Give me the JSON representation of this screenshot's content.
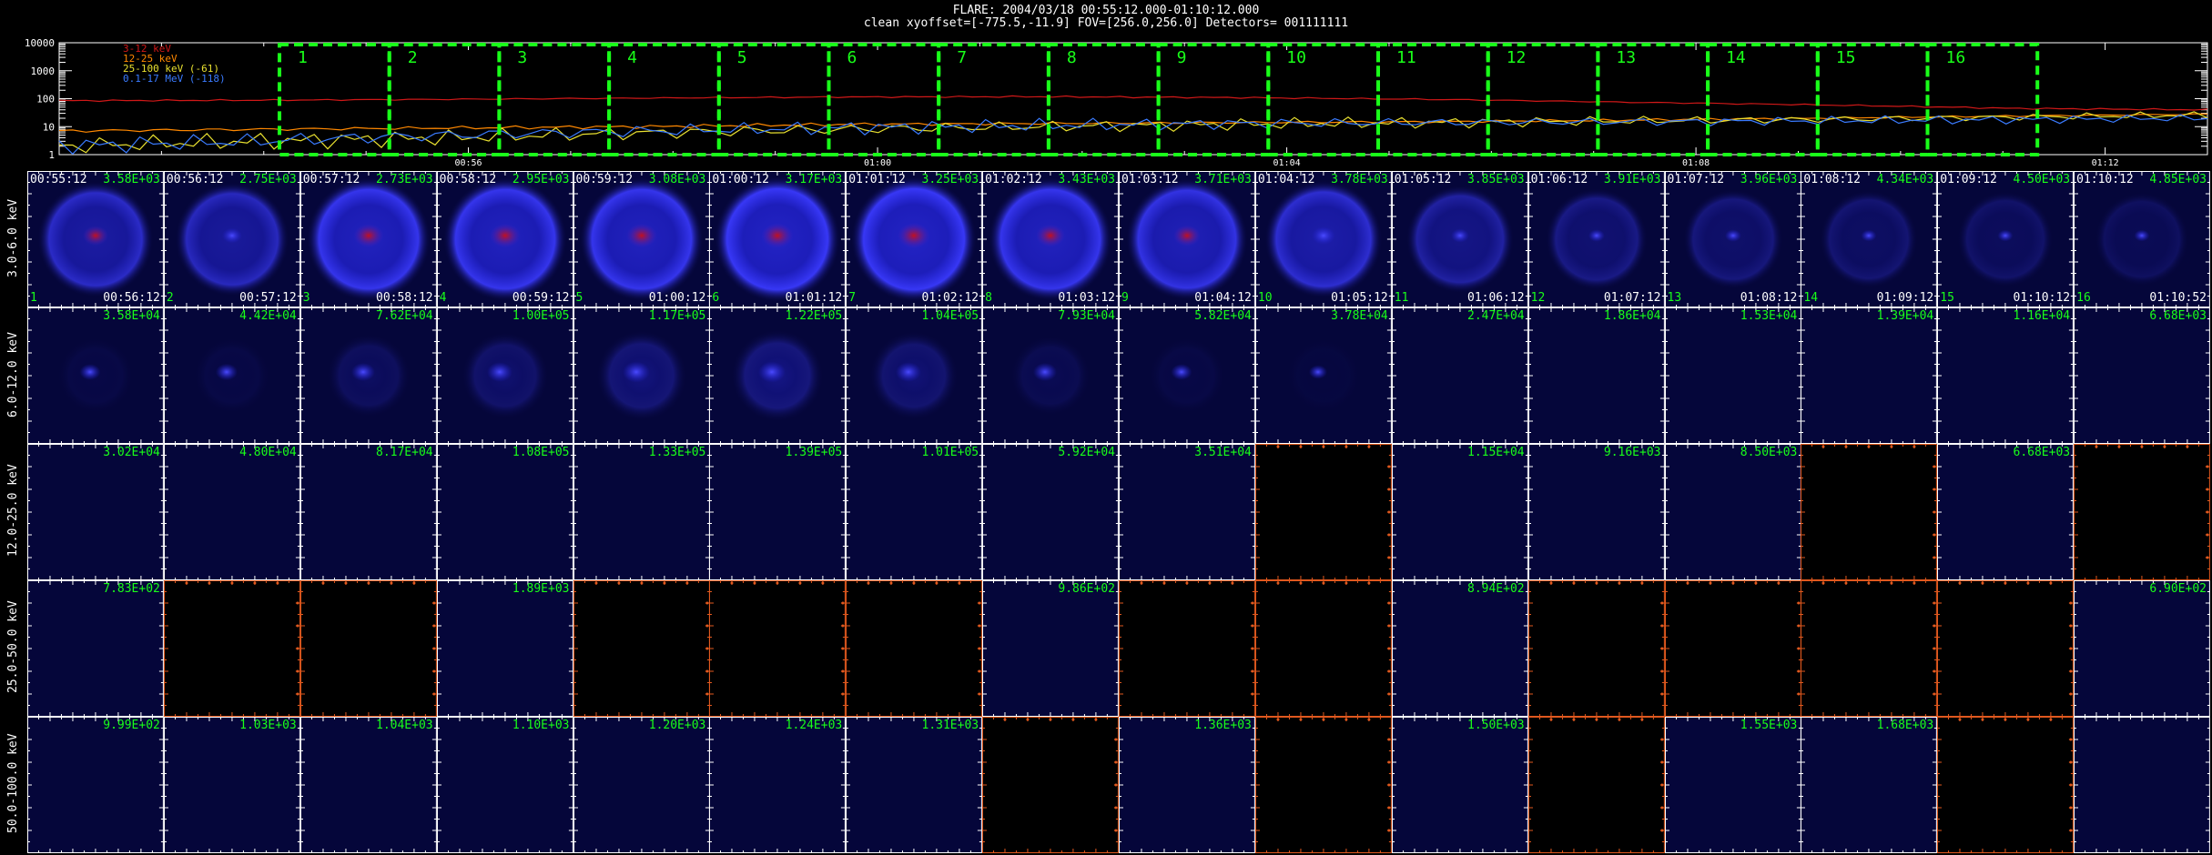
{
  "header": {
    "title": "FLARE: 2004/03/18 00:55:12.000-01:10:12.000",
    "subtitle": "clean    xyoffset=[-775.5,-11.9]    FOV=[256.0,256.0]    Detectors= 001111111"
  },
  "lightcurve": {
    "yticks": [
      "10000",
      "1000",
      "100",
      "10",
      "1"
    ],
    "xticks": [
      "00:56",
      "01:00",
      "01:04",
      "01:08",
      "01:12"
    ],
    "legend": [
      {
        "label": "3-12 keV",
        "color": "#d01818"
      },
      {
        "label": "12-25 keV",
        "color": "#ff8800"
      },
      {
        "label": "25-100 keV (-61)",
        "color": "#e8e030"
      },
      {
        "label": "0.1-17 MeV (-118)",
        "color": "#3a7bff"
      }
    ],
    "boxes": [
      "1",
      "2",
      "3",
      "4",
      "5",
      "6",
      "7",
      "8",
      "9",
      "10",
      "11",
      "12",
      "13",
      "14",
      "15",
      "16"
    ],
    "box_color": "#19ff19"
  },
  "chart_data": {
    "type": "line",
    "title": "FLARE: 2004/03/18 00:55:12.000-01:10:12.000",
    "xlabel": "",
    "ylabel": "",
    "yscale": "log",
    "ylim": [
      1,
      10000
    ],
    "xlim": [
      "00:52",
      "01:13"
    ],
    "x": [
      "00:52",
      "00:54",
      "00:56",
      "00:58",
      "01:00",
      "01:02",
      "01:04",
      "01:06",
      "01:08",
      "01:10",
      "01:12",
      "01:13"
    ],
    "series": [
      {
        "name": "3-12 keV",
        "color": "#d01818",
        "values": [
          85,
          88,
          95,
          105,
          115,
          118,
          110,
          95,
          75,
          60,
          45,
          40
        ]
      },
      {
        "name": "12-25 keV",
        "color": "#ff8800",
        "values": [
          7,
          8,
          9,
          10,
          12,
          13,
          14,
          15,
          17,
          20,
          24,
          28
        ]
      },
      {
        "name": "25-100 keV (-61)",
        "color": "#e8e030",
        "values": [
          2,
          3,
          4,
          6,
          8,
          10,
          12,
          14,
          16,
          18,
          22,
          26
        ]
      },
      {
        "name": "0.1-17 MeV (-118)",
        "color": "#3a7bff",
        "values": [
          2,
          3,
          5,
          7,
          9,
          11,
          13,
          14,
          15,
          16,
          18,
          20
        ]
      }
    ]
  },
  "rows": [
    {
      "label": "3.0-6.0 keV",
      "tl": [
        "00:55:12",
        "00:56:12",
        "00:57:12",
        "00:58:12",
        "00:59:12",
        "01:00:12",
        "01:01:12",
        "01:02:12",
        "01:03:12",
        "01:04:12",
        "01:05:12",
        "01:06:12",
        "01:07:12",
        "01:08:12",
        "01:09:12",
        "01:10:12"
      ],
      "tr": [
        "3.58E+03",
        "2.75E+03",
        "2.73E+03",
        "2.95E+03",
        "3.08E+03",
        "3.17E+03",
        "3.25E+03",
        "3.43E+03",
        "3.71E+03",
        "3.78E+03",
        "3.85E+03",
        "3.91E+03",
        "3.96E+03",
        "4.34E+03",
        "4.50E+03",
        "4.85E+03"
      ],
      "bl": [
        "1",
        "2",
        "3",
        "4",
        "5",
        "6",
        "7",
        "8",
        "9",
        "10",
        "11",
        "12",
        "13",
        "14",
        "15",
        "16"
      ],
      "br": [
        "00:56:12",
        "00:57:12",
        "00:58:12",
        "00:59:12",
        "01:00:12",
        "01:01:12",
        "01:02:12",
        "01:03:12",
        "01:04:12",
        "01:05:12",
        "01:06:12",
        "01:07:12",
        "01:08:12",
        "01:09:12",
        "01:10:12",
        "01:10:52"
      ],
      "intensity": [
        0.75,
        0.7,
        0.95,
        0.95,
        0.95,
        1.0,
        1.0,
        0.95,
        0.9,
        0.8,
        0.55,
        0.4,
        0.35,
        0.3,
        0.25,
        0.2
      ],
      "core": [
        0.6,
        0.3,
        0.85,
        0.9,
        0.9,
        0.95,
        1.0,
        0.8,
        0.7,
        0.5,
        0.2,
        0.1,
        0.1,
        0.05,
        0.05,
        0.05
      ],
      "empty": [
        false,
        false,
        false,
        false,
        false,
        false,
        false,
        false,
        false,
        false,
        false,
        false,
        false,
        false,
        false,
        false
      ]
    },
    {
      "label": "6.0-12.0 keV",
      "tr": [
        "3.58E+04",
        "4.42E+04",
        "7.62E+04",
        "1.00E+05",
        "1.17E+05",
        "1.22E+05",
        "1.04E+05",
        "7.93E+04",
        "5.82E+04",
        "3.78E+04",
        "2.47E+04",
        "1.86E+04",
        "1.53E+04",
        "1.39E+04",
        "1.16E+04",
        "6.68E+03"
      ],
      "intensity": [
        0.1,
        0.1,
        0.3,
        0.4,
        0.5,
        0.55,
        0.45,
        0.2,
        0.1,
        0.05,
        0,
        0,
        0,
        0,
        0,
        0
      ],
      "core": [
        0.35,
        0.4,
        0.5,
        0.6,
        0.7,
        0.7,
        0.6,
        0.5,
        0.35,
        0.2,
        0,
        0,
        0,
        0,
        0,
        0
      ],
      "empty": [
        false,
        false,
        false,
        false,
        false,
        false,
        false,
        false,
        false,
        false,
        false,
        false,
        false,
        false,
        false,
        false
      ]
    },
    {
      "label": "12.0-25.0 keV",
      "tr": [
        "3.02E+04",
        "4.80E+04",
        "8.17E+04",
        "1.08E+05",
        "1.33E+05",
        "1.39E+05",
        "1.01E+05",
        "5.92E+04",
        "3.51E+04",
        "",
        "1.15E+04",
        "9.16E+03",
        "8.50E+03",
        "",
        "6.68E+03",
        ""
      ],
      "intensity": [
        0,
        0,
        0,
        0,
        0,
        0,
        0,
        0,
        0,
        0,
        0,
        0,
        0,
        0,
        0,
        0
      ],
      "core": [
        0,
        0,
        0,
        0,
        0,
        0,
        0,
        0,
        0,
        0,
        0,
        0,
        0,
        0,
        0,
        0
      ],
      "empty": [
        false,
        false,
        false,
        false,
        false,
        false,
        false,
        false,
        false,
        true,
        false,
        false,
        false,
        true,
        false,
        true
      ]
    },
    {
      "label": "25.0-50.0 keV",
      "tr": [
        "7.83E+02",
        "",
        "",
        "1.89E+03",
        "",
        "",
        "",
        "9.86E+02",
        "",
        "",
        "8.94E+02",
        "",
        "",
        "",
        "",
        "6.90E+02"
      ],
      "intensity": [
        0,
        0,
        0,
        0,
        0,
        0,
        0,
        0,
        0,
        0,
        0,
        0,
        0,
        0,
        0,
        0
      ],
      "core": [
        0,
        0,
        0,
        0,
        0,
        0,
        0,
        0,
        0,
        0,
        0,
        0,
        0,
        0,
        0,
        0
      ],
      "empty": [
        false,
        true,
        true,
        false,
        true,
        true,
        true,
        false,
        true,
        true,
        false,
        true,
        true,
        true,
        true,
        false
      ]
    },
    {
      "label": "50.0-100.0 keV",
      "tr": [
        "9.99E+02",
        "1.03E+03",
        "1.04E+03",
        "1.10E+03",
        "1.20E+03",
        "1.24E+03",
        "1.31E+03",
        "",
        "1.36E+03",
        "",
        "1.50E+03",
        "",
        "1.55E+03",
        "1.68E+03",
        "",
        ""
      ],
      "intensity": [
        0,
        0,
        0,
        0,
        0,
        0,
        0,
        0,
        0,
        0,
        0,
        0,
        0,
        0,
        0,
        0
      ],
      "core": [
        0,
        0,
        0,
        0,
        0,
        0,
        0,
        0,
        0,
        0,
        0,
        0,
        0,
        0,
        0,
        0
      ],
      "empty": [
        false,
        false,
        false,
        false,
        false,
        false,
        false,
        true,
        false,
        true,
        false,
        true,
        false,
        false,
        true,
        false
      ]
    },
    {
      "label_color": "#ffffff"
    }
  ],
  "colors": {
    "empty_border": "#e0581e",
    "cell_bg": "#05063a",
    "tick": "#ffffff",
    "text_green": "#19ff19",
    "text_white": "#ffffff"
  }
}
